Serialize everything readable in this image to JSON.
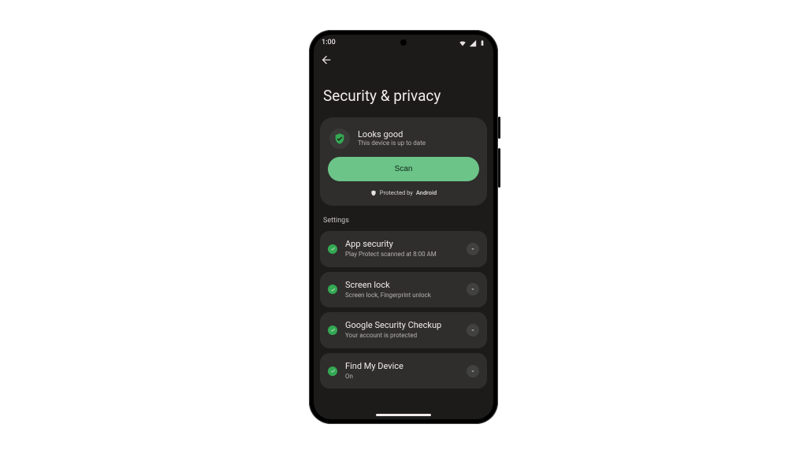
{
  "status_bar": {
    "time": "1:00"
  },
  "page": {
    "title": "Security & privacy"
  },
  "summary": {
    "title": "Looks good",
    "subtitle": "This device is up to date",
    "scan_label": "Scan",
    "protected_prefix": "Protected by ",
    "protected_brand": "Android"
  },
  "section_label": "Settings",
  "items": [
    {
      "title": "App security",
      "subtitle": "Play Protect scanned at 8:00 AM"
    },
    {
      "title": "Screen lock",
      "subtitle": "Screen lock, Fingerprint unlock"
    },
    {
      "title": "Google Security Checkup",
      "subtitle": "Your account is protected"
    },
    {
      "title": "Find My Device",
      "subtitle": "On"
    }
  ],
  "colors": {
    "accent_green": "#6cc488",
    "chip_bg": "#2f2e2c",
    "screen_bg": "#1c1b1a"
  }
}
